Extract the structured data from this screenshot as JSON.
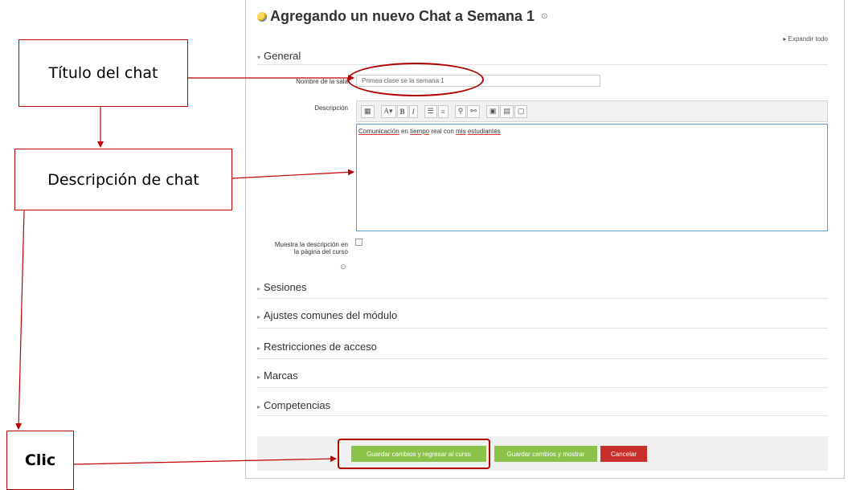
{
  "page": {
    "title": "Agregando un nuevo Chat a Semana 1",
    "help_icon": "question-circle-icon",
    "expand_all": "Expandir todo"
  },
  "sections": {
    "general": "General",
    "sesiones": "Sesiones",
    "ajustes": "Ajustes comunes del módulo",
    "restricciones": "Restricciones de acceso",
    "marcas": "Marcas",
    "competencias": "Competencias"
  },
  "form": {
    "name_label": "Nombre de la sala",
    "name_value": "Primea clase se la semana 1",
    "description_label": "Descripción",
    "description_words": [
      "Comunicación",
      "en",
      "tiempo",
      "real con",
      "mis",
      "estudiantes"
    ],
    "show_description_label_line1": "Muestra la descripción en",
    "show_description_label_line2": "la página del curso",
    "show_description_checked": false
  },
  "toolbar": {
    "items": [
      "table-icon",
      "font-color-icon",
      "bold-icon",
      "italic-icon",
      "bullet-list-icon",
      "numbered-list-icon",
      "link-icon",
      "unlink-icon",
      "image-icon",
      "media-icon",
      "paste-icon"
    ],
    "bold": "B",
    "italic": "I"
  },
  "buttons": {
    "save_return": "Guardar cambios y regresar al curso",
    "save_show": "Guardar cambios y mostrar",
    "cancel": "Cancelar"
  },
  "annotations": {
    "title_box": "Título del chat",
    "description_box": "Descripción de chat",
    "click_box": "Clic"
  },
  "colors": {
    "annotation": "#c00000",
    "save_buttons": "#8bc34a",
    "cancel_button": "#c9302c",
    "editor_border": "#5b9bd5"
  }
}
